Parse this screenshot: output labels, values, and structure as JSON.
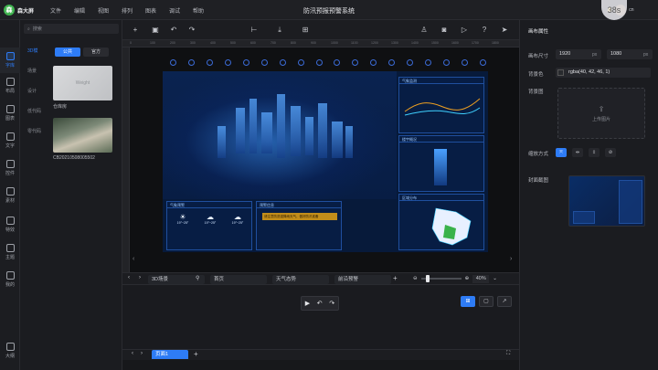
{
  "app": {
    "brand": "森大屏",
    "title": "防汛预报预警系统"
  },
  "menu": [
    "文件",
    "编辑",
    "视图",
    "排列",
    "图表",
    "调试",
    "帮助"
  ],
  "user": {
    "name": "cn"
  },
  "recording_badge": "38s",
  "rail": [
    {
      "label": "字库",
      "active": true
    },
    {
      "label": "布局"
    },
    {
      "label": "图表"
    },
    {
      "label": "文字"
    },
    {
      "label": "控件"
    },
    {
      "label": "素材"
    },
    {
      "label": "特效"
    },
    {
      "label": "主题"
    },
    {
      "label": "我的"
    },
    {
      "label": "大纲"
    }
  ],
  "side": {
    "search_placeholder": "搜索",
    "categories": [
      "3D模",
      "场景",
      "设计",
      "低代码",
      "零代码"
    ],
    "tabs": [
      {
        "label": "公共",
        "on": true
      },
      {
        "label": "官方"
      }
    ],
    "thumbs": [
      {
        "caption": "仓库房",
        "inner": "Weight"
      },
      {
        "caption": "CB20210508005502"
      }
    ]
  },
  "ruler": [
    "0",
    "100",
    "200",
    "300",
    "400",
    "500",
    "600",
    "700",
    "800",
    "900",
    "1000",
    "1100",
    "1200",
    "1300",
    "1400",
    "1500",
    "1600",
    "1700",
    "1800"
  ],
  "board": {
    "panels": {
      "weather_title": "气象监测",
      "building_title": "楼宇概况",
      "forecast_title": "气象预警",
      "alert_title": "预警信息",
      "alert_text": "请注意防范强降雨天气，做好防汛准备",
      "map_title": "区域分布"
    },
    "forecast": [
      {
        "sym": "☀",
        "temp": "19°~25°"
      },
      {
        "sym": "☁",
        "temp": "19°~25°"
      },
      {
        "sym": "☁",
        "temp": "19°~25°"
      }
    ]
  },
  "timeline": {
    "layers": [
      "3D场景",
      "首页",
      "天气态势",
      "前沿预警"
    ],
    "zoom": "40%",
    "zoom_fraction": 0.12
  },
  "pages": [
    "页面1"
  ],
  "right": {
    "header": "画布属性",
    "size_label": "画布尺寸",
    "width": "1920",
    "height": "1080",
    "unit": "px",
    "bg_color_label": "背景色",
    "bg_color": "rgba(40, 42, 46, 1)",
    "bg_image_label": "背景图",
    "upload_text": "上传图片",
    "fit_label": "缩放方式",
    "cover_label": "封面截图"
  }
}
